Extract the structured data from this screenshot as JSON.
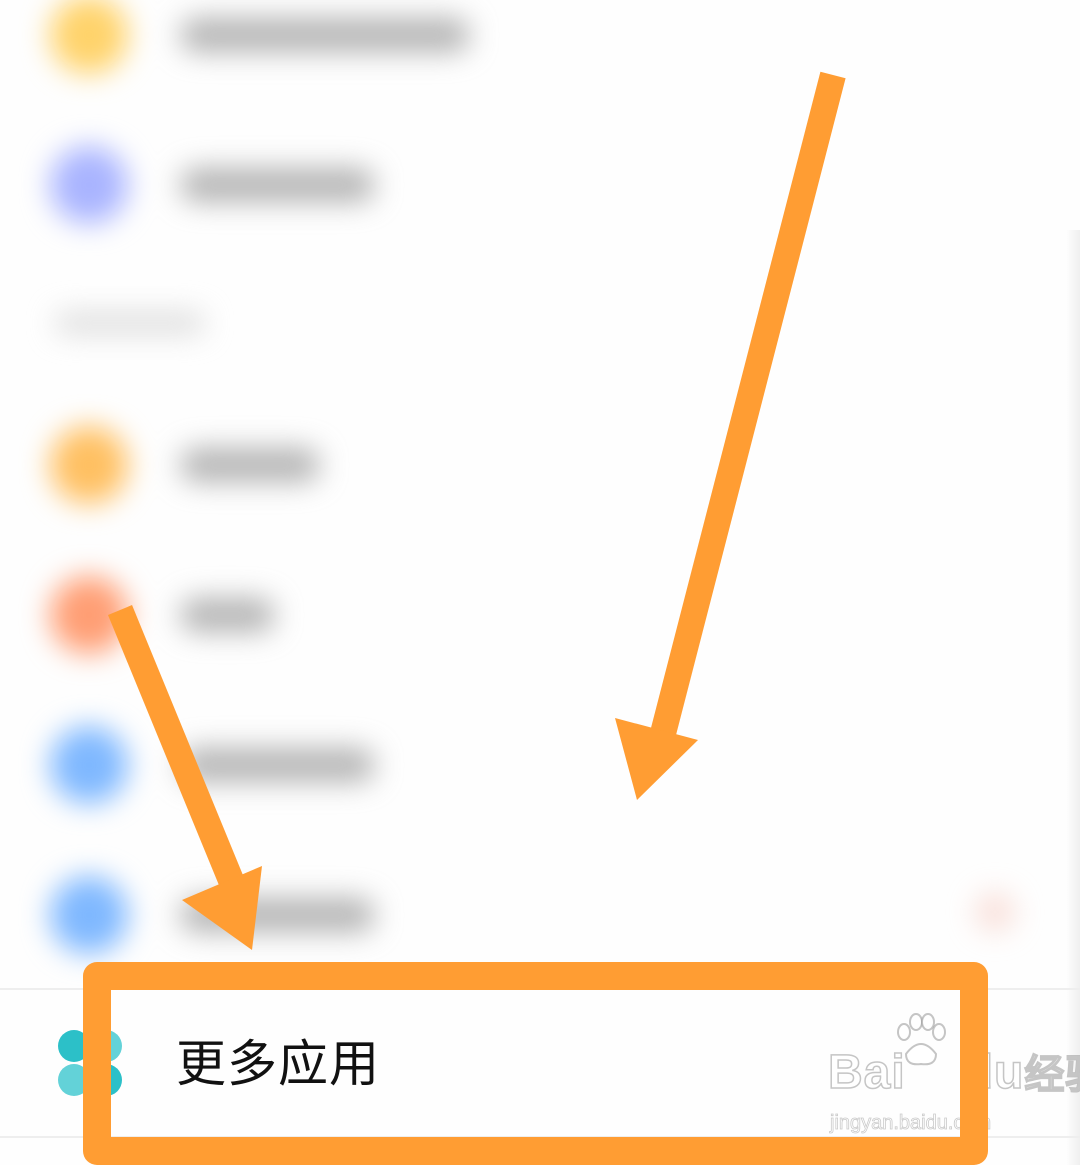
{
  "more_apps": {
    "label": "更多应用",
    "icon": "more-apps-icon",
    "icon_colors": [
      "#2cc0c8",
      "#63d2d8"
    ]
  },
  "blurred_rows": [
    {
      "icon_color": "#ffd36b"
    },
    {
      "icon_color": "#a9b4ff"
    },
    {
      "icon_color": "#ffc062"
    },
    {
      "icon_color": "#ff9e74"
    },
    {
      "icon_color": "#7fb8ff"
    },
    {
      "icon_color": "#7fb8ff"
    }
  ],
  "annotation": {
    "highlight_color": "#ff9d33",
    "arrow_color": "#ff9d33"
  },
  "watermark": {
    "brand": "Bai",
    "brand_suffix": "du",
    "brand_cn": "经验",
    "url": "jingyan.baidu.com"
  }
}
